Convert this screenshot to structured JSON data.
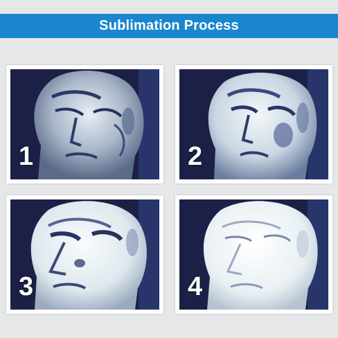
{
  "title": "Sublimation Process",
  "steps": [
    {
      "number": "1"
    },
    {
      "number": "2"
    },
    {
      "number": "3"
    },
    {
      "number": "4"
    }
  ],
  "colors": {
    "page_background": "#e6e7e8",
    "title_bar": "#1a86cf",
    "title_text": "#ffffff",
    "photo_background": "#1c2046"
  }
}
